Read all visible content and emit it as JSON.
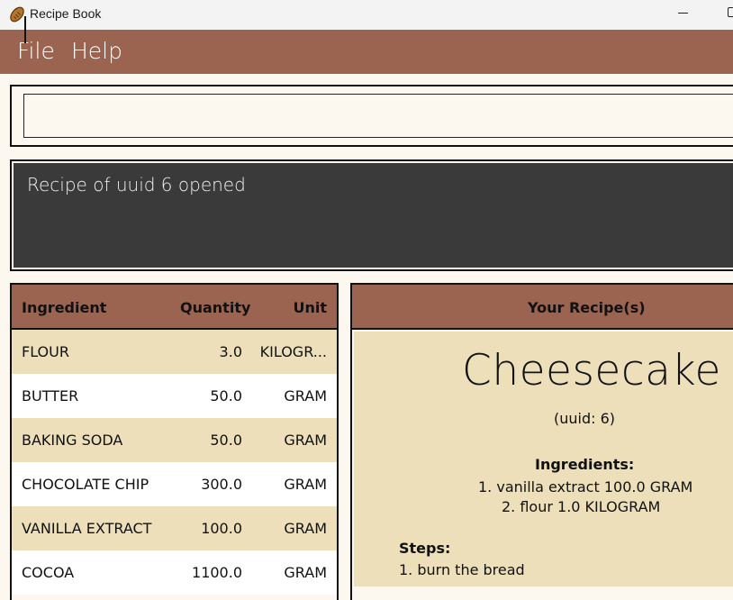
{
  "window": {
    "title": "Recipe Book",
    "icon": "bread-loaf-icon"
  },
  "menu": {
    "items": [
      {
        "label": "File"
      },
      {
        "label": "Help"
      }
    ]
  },
  "command_box": {
    "value": "",
    "placeholder": ""
  },
  "result_display": {
    "text": "Recipe of uuid 6 opened"
  },
  "ingredient_table": {
    "headers": {
      "ingredient": "Ingredient",
      "quantity": "Quantity",
      "unit": "Unit"
    },
    "rows": [
      {
        "ingredient": "FLOUR",
        "quantity": "3.0",
        "unit": "KILOGR..."
      },
      {
        "ingredient": "BUTTER",
        "quantity": "50.0",
        "unit": "GRAM"
      },
      {
        "ingredient": "BAKING SODA",
        "quantity": "50.0",
        "unit": "GRAM"
      },
      {
        "ingredient": "CHOCOLATE CHIP",
        "quantity": "300.0",
        "unit": "GRAM"
      },
      {
        "ingredient": "VANILLA EXTRACT",
        "quantity": "100.0",
        "unit": "GRAM"
      },
      {
        "ingredient": "COCOA",
        "quantity": "1100.0",
        "unit": "GRAM"
      }
    ]
  },
  "recipe_panel": {
    "header": "Your Recipe(s)",
    "recipe": {
      "name": "Cheesecake",
      "uuid_text": "(uuid: 6)",
      "ingredients_title": "Ingredients:",
      "ingredients": [
        "1. vanilla extract 100.0 GRAM",
        "2. flour 1.0 KILOGRAM"
      ],
      "steps_title": "Steps:",
      "steps": [
        "1. burn the bread"
      ]
    }
  },
  "colors": {
    "accent": "#9b6451",
    "row_alt": "#ecdfba",
    "result_bg": "#3a3a3a",
    "background": "#fdf8ef"
  }
}
